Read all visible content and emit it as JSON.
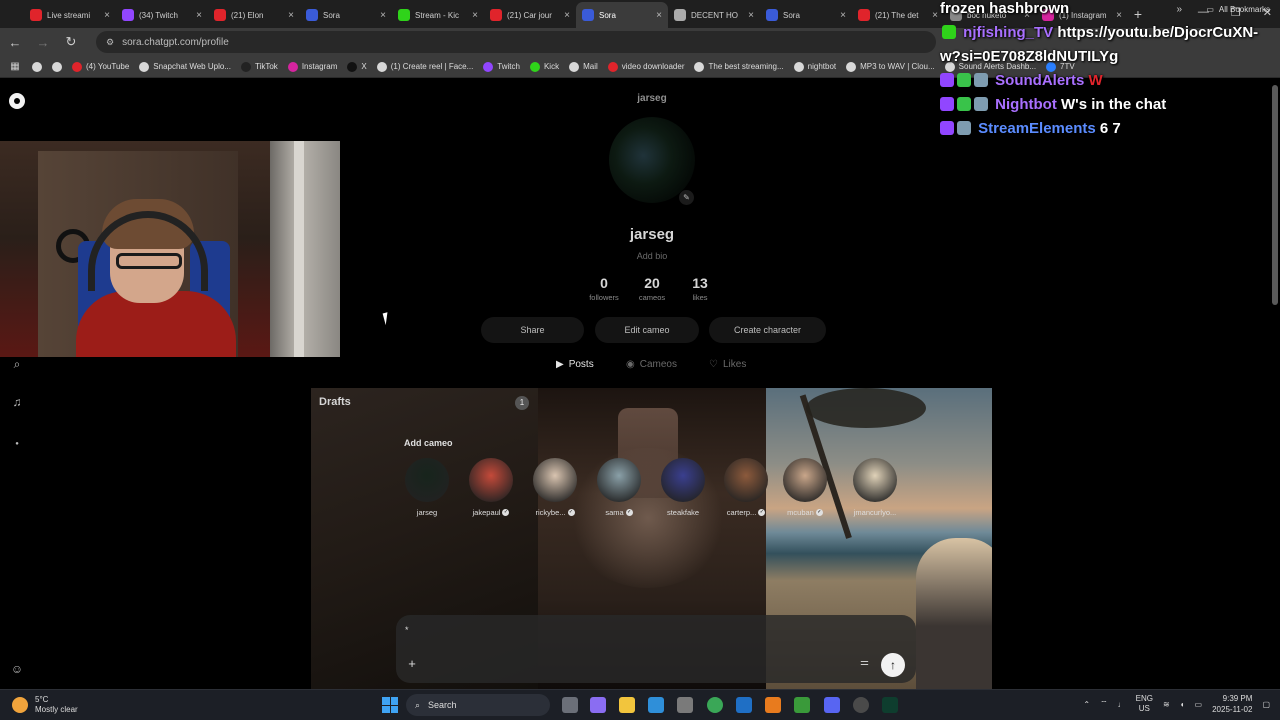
{
  "browser": {
    "tabs": [
      {
        "label": "Live streami",
        "color": "#e0242b"
      },
      {
        "label": "(34) Twitch",
        "color": "#9146ff"
      },
      {
        "label": "(21) Elon",
        "color": "#e0242b"
      },
      {
        "label": "Sora",
        "color": "#3a5bd9"
      },
      {
        "label": "Stream - Kic",
        "color": "#2fd31a"
      },
      {
        "label": "(21) Car jour",
        "color": "#e0242b"
      },
      {
        "label": "Sora",
        "color": "#3a5bd9",
        "active": true
      },
      {
        "label": "DECENT HO",
        "color": "#aaaaaa"
      },
      {
        "label": "Sora",
        "color": "#3a5bd9"
      },
      {
        "label": "(21) The det",
        "color": "#e0242b"
      },
      {
        "label": "boc nuketo",
        "color": "#888888"
      },
      {
        "label": "(1) Instagram",
        "color": "#d6249f"
      }
    ],
    "new_tab": "+",
    "url": "sora.chatgpt.com/profile",
    "bookmarks": [
      {
        "label": "(4) YouTube",
        "color": "#e0242b"
      },
      {
        "label": "Snapchat Web Uplo...",
        "color": "#d8d8d8"
      },
      {
        "label": "TikTok",
        "color": "#222222"
      },
      {
        "label": "Instagram",
        "color": "#d6249f"
      },
      {
        "label": "X",
        "color": "#111111"
      },
      {
        "label": "(1) Create reel | Face...",
        "color": "#d8d8d8"
      },
      {
        "label": "Twitch",
        "color": "#9146ff"
      },
      {
        "label": "Kick",
        "color": "#2fd31a"
      },
      {
        "label": "Mail",
        "color": "#d8d8d8"
      },
      {
        "label": "video downloader",
        "color": "#e0242b"
      },
      {
        "label": "The best streaming...",
        "color": "#d8d8d8"
      },
      {
        "label": "nightbot",
        "color": "#d8d8d8"
      },
      {
        "label": "MP3 to WAV | Clou...",
        "color": "#d8d8d8"
      },
      {
        "label": "Sound Alerts Dashb...",
        "color": "#d8d8d8"
      },
      {
        "label": "7TV",
        "color": "#2a7fff"
      }
    ],
    "all_bookmarks": "All Bookmarks"
  },
  "profile": {
    "header_username": "jarseg",
    "display_name": "jarseg",
    "bio_placeholder": "Add bio",
    "stats": [
      {
        "value": "0",
        "label": "followers"
      },
      {
        "value": "20",
        "label": "cameos"
      },
      {
        "value": "13",
        "label": "likes"
      }
    ],
    "actions": {
      "share": "Share",
      "edit_cameo": "Edit cameo",
      "create_character": "Create character"
    },
    "tabs": {
      "posts": "Posts",
      "cameos": "Cameos",
      "likes": "Likes"
    },
    "drafts_label": "Drafts",
    "drafts_count": "1"
  },
  "composer": {
    "add_cameo_label": "Add cameo",
    "cameos": [
      {
        "name": "jarseg",
        "verified": false,
        "color": "#17241c"
      },
      {
        "name": "jakepaul",
        "verified": true,
        "color": "#c44a3a"
      },
      {
        "name": "rickybe...",
        "verified": true,
        "color": "#d9c4b0"
      },
      {
        "name": "sama",
        "verified": true,
        "color": "#8aa0a8"
      },
      {
        "name": "steakfake",
        "verified": false,
        "color": "#3a3f8f"
      },
      {
        "name": "carterp...",
        "verified": true,
        "color": "#8c5a3c"
      },
      {
        "name": "mcuban",
        "verified": true,
        "color": "#c9a68a"
      },
      {
        "name": "jmancurlyo...",
        "verified": false,
        "color": "#e0d2b8"
      }
    ],
    "input_text": "*",
    "plus": "+",
    "send": "↑"
  },
  "chat": {
    "line1": "frozen hashbrown",
    "line2_user": "njfishing_TV",
    "line2_msg": "https://youtu.be/DjocrCuXN-",
    "line3": "w?si=0E708Z8ldNUTILYg",
    "line4_user": "SoundAlerts",
    "line4_msg": "W",
    "line5_user": "Nightbot",
    "line5_msg": "W's in the chat",
    "line6_user": "StreamElements",
    "line6_msg": "6 7",
    "name_color": "#a970ff"
  },
  "taskbar": {
    "temperature": "5°C",
    "weather": "Mostly clear",
    "search": "Search",
    "lang1": "ENG",
    "lang2": "US",
    "time": "9:39 PM",
    "date": "2025-11-02"
  }
}
